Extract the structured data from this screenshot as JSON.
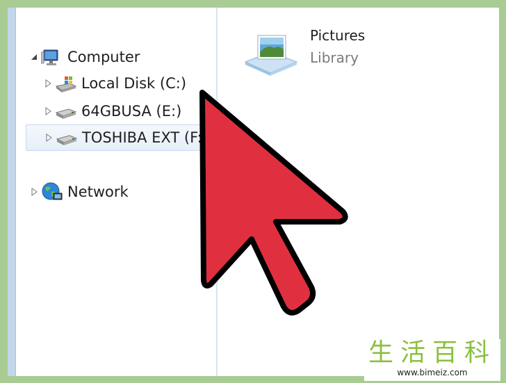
{
  "nav": {
    "computer": "Computer",
    "drives": [
      {
        "label": "Local Disk (C:)",
        "icon": "windows-drive-icon"
      },
      {
        "label": "64GBUSA (E:)",
        "icon": "usb-drive-icon"
      },
      {
        "label": "TOSHIBA EXT (F:)",
        "icon": "usb-drive-icon",
        "selected": true
      }
    ],
    "network": "Network"
  },
  "library": {
    "title": "Pictures",
    "subtitle": "Library"
  },
  "watermark": {
    "text": "生活百科",
    "url": "www.bimeiz.com"
  },
  "colors": {
    "background": "#a9cc94",
    "cursor_fill": "#e03040",
    "selection": "#e6effa",
    "watermark_green": "#8cbf3f"
  }
}
